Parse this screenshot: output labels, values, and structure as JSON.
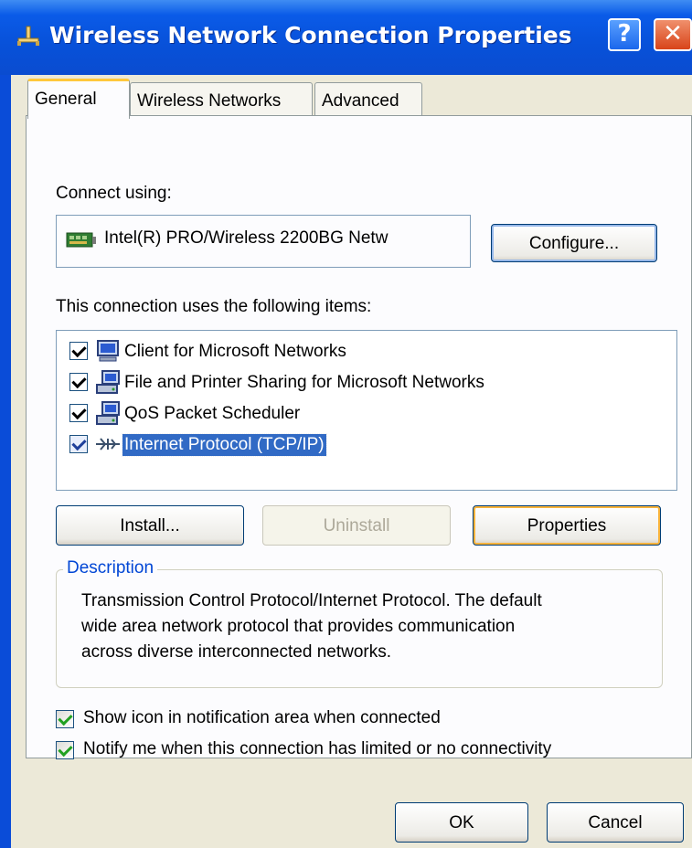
{
  "window": {
    "title": "Wireless Network Connection Properties",
    "help_glyph": "?",
    "close_glyph": "✕"
  },
  "tabs": [
    {
      "label": "General",
      "active": true
    },
    {
      "label": "Wireless Networks",
      "active": false
    },
    {
      "label": "Advanced",
      "active": false
    }
  ],
  "general": {
    "connect_using_label": "Connect using:",
    "adapter_name": "Intel(R) PRO/Wireless 2200BG Netw",
    "configure_button": "Configure...",
    "items_label": "This connection uses the following items:",
    "items": [
      {
        "label": "Client for Microsoft Networks",
        "checked": true,
        "selected": false,
        "icon": "network-client-icon"
      },
      {
        "label": "File and Printer Sharing for Microsoft Networks",
        "checked": true,
        "selected": false,
        "icon": "network-service-icon"
      },
      {
        "label": "QoS Packet Scheduler",
        "checked": true,
        "selected": false,
        "icon": "network-service-icon"
      },
      {
        "label": "Internet Protocol (TCP/IP)",
        "checked": true,
        "selected": true,
        "icon": "network-protocol-icon"
      }
    ],
    "install_button": "Install...",
    "uninstall_button": "Uninstall",
    "properties_button": "Properties",
    "description_title": "Description",
    "description_lines": [
      "Transmission Control Protocol/Internet Protocol. The default",
      "wide area network protocol that provides communication",
      "across diverse interconnected networks."
    ],
    "show_icon_label": "Show icon in notification area when connected",
    "show_icon_checked": true,
    "notify_label": "Notify me when this connection has limited or no connectivity",
    "notify_checked": true
  },
  "footer": {
    "ok_button": "OK",
    "cancel_button": "Cancel"
  },
  "colors": {
    "titlebar": "#0a5be8",
    "dialog_face": "#ece9d8",
    "selection": "#316ac5",
    "description_title": "#0046d5",
    "focus_highlight": "#f8b33b"
  }
}
